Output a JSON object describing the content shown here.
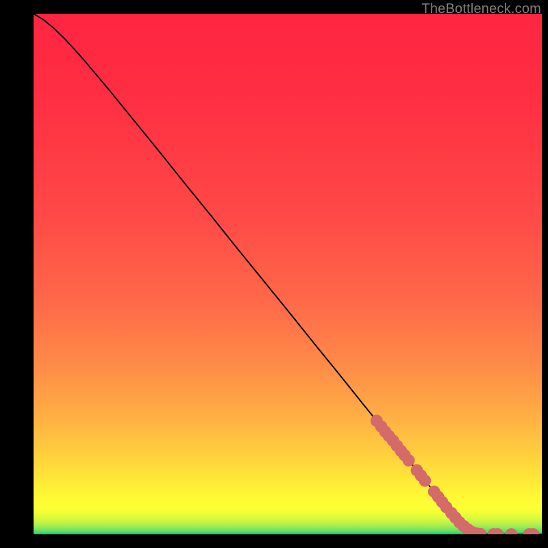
{
  "watermark": "TheBottleneck.com",
  "chart_data": {
    "type": "line",
    "title": "",
    "xlabel": "",
    "ylabel": "",
    "xlim": [
      0,
      100
    ],
    "ylim": [
      0,
      100
    ],
    "grid": false,
    "legend": false,
    "gradient_stops": [
      {
        "offset": 0.0,
        "color": "#00d183"
      },
      {
        "offset": 0.005,
        "color": "#55dd6b"
      },
      {
        "offset": 0.012,
        "color": "#8de858"
      },
      {
        "offset": 0.021,
        "color": "#baf247"
      },
      {
        "offset": 0.032,
        "color": "#dffa3a"
      },
      {
        "offset": 0.047,
        "color": "#f9ff32"
      },
      {
        "offset": 0.066,
        "color": "#fffb33"
      },
      {
        "offset": 0.091,
        "color": "#ffef36"
      },
      {
        "offset": 0.125,
        "color": "#ffde3a"
      },
      {
        "offset": 0.172,
        "color": "#ffc73f"
      },
      {
        "offset": 0.236,
        "color": "#ffab44"
      },
      {
        "offset": 0.325,
        "color": "#ff8b48"
      },
      {
        "offset": 0.446,
        "color": "#ff6949"
      },
      {
        "offset": 0.612,
        "color": "#ff4947"
      },
      {
        "offset": 0.841,
        "color": "#ff2e42"
      },
      {
        "offset": 1.0,
        "color": "#ff2542"
      }
    ],
    "series": [
      {
        "name": "curve",
        "stroke": "#000000",
        "points": [
          {
            "x": 0.0,
            "y": 100.0
          },
          {
            "x": 2.0,
            "y": 98.8
          },
          {
            "x": 4.0,
            "y": 97.2
          },
          {
            "x": 6.0,
            "y": 95.3
          },
          {
            "x": 8.0,
            "y": 93.2
          },
          {
            "x": 10.0,
            "y": 91.0
          },
          {
            "x": 15.0,
            "y": 85.2
          },
          {
            "x": 20.0,
            "y": 79.2
          },
          {
            "x": 25.0,
            "y": 73.2
          },
          {
            "x": 30.0,
            "y": 67.1
          },
          {
            "x": 35.0,
            "y": 61.1
          },
          {
            "x": 40.0,
            "y": 55.0
          },
          {
            "x": 45.0,
            "y": 49.0
          },
          {
            "x": 50.0,
            "y": 43.0
          },
          {
            "x": 55.0,
            "y": 36.9
          },
          {
            "x": 60.0,
            "y": 30.9
          },
          {
            "x": 65.0,
            "y": 24.8
          },
          {
            "x": 70.0,
            "y": 18.8
          },
          {
            "x": 75.0,
            "y": 12.8
          },
          {
            "x": 80.0,
            "y": 6.7
          },
          {
            "x": 85.0,
            "y": 1.5
          },
          {
            "x": 87.0,
            "y": 0.4
          },
          {
            "x": 88.0,
            "y": 0.1
          },
          {
            "x": 90.0,
            "y": 0.0
          },
          {
            "x": 95.0,
            "y": 0.0
          },
          {
            "x": 100.0,
            "y": 0.0
          }
        ]
      }
    ],
    "markers": {
      "color": "#d46a6a",
      "radius": 1.2,
      "points": [
        {
          "x": 67.5,
          "y": 21.8
        },
        {
          "x": 68.4,
          "y": 20.7
        },
        {
          "x": 69.2,
          "y": 19.7
        },
        {
          "x": 69.9,
          "y": 18.9
        },
        {
          "x": 70.7,
          "y": 18.0
        },
        {
          "x": 71.5,
          "y": 17.0
        },
        {
          "x": 72.3,
          "y": 16.0
        },
        {
          "x": 73.0,
          "y": 15.2
        },
        {
          "x": 73.8,
          "y": 14.2
        },
        {
          "x": 75.4,
          "y": 12.3
        },
        {
          "x": 76.2,
          "y": 11.3
        },
        {
          "x": 77.0,
          "y": 10.3
        },
        {
          "x": 78.8,
          "y": 8.2
        },
        {
          "x": 79.6,
          "y": 7.2
        },
        {
          "x": 80.4,
          "y": 6.2
        },
        {
          "x": 81.2,
          "y": 5.2
        },
        {
          "x": 82.2,
          "y": 4.1
        },
        {
          "x": 83.0,
          "y": 3.2
        },
        {
          "x": 83.8,
          "y": 2.3
        },
        {
          "x": 84.6,
          "y": 1.6
        },
        {
          "x": 85.5,
          "y": 0.9
        },
        {
          "x": 86.3,
          "y": 0.4
        },
        {
          "x": 87.1,
          "y": 0.15
        },
        {
          "x": 87.9,
          "y": 0.05
        },
        {
          "x": 90.5,
          "y": 0.0
        },
        {
          "x": 91.3,
          "y": 0.0
        },
        {
          "x": 94.0,
          "y": 0.0
        },
        {
          "x": 97.5,
          "y": 0.0
        },
        {
          "x": 98.3,
          "y": 0.0
        }
      ]
    }
  }
}
